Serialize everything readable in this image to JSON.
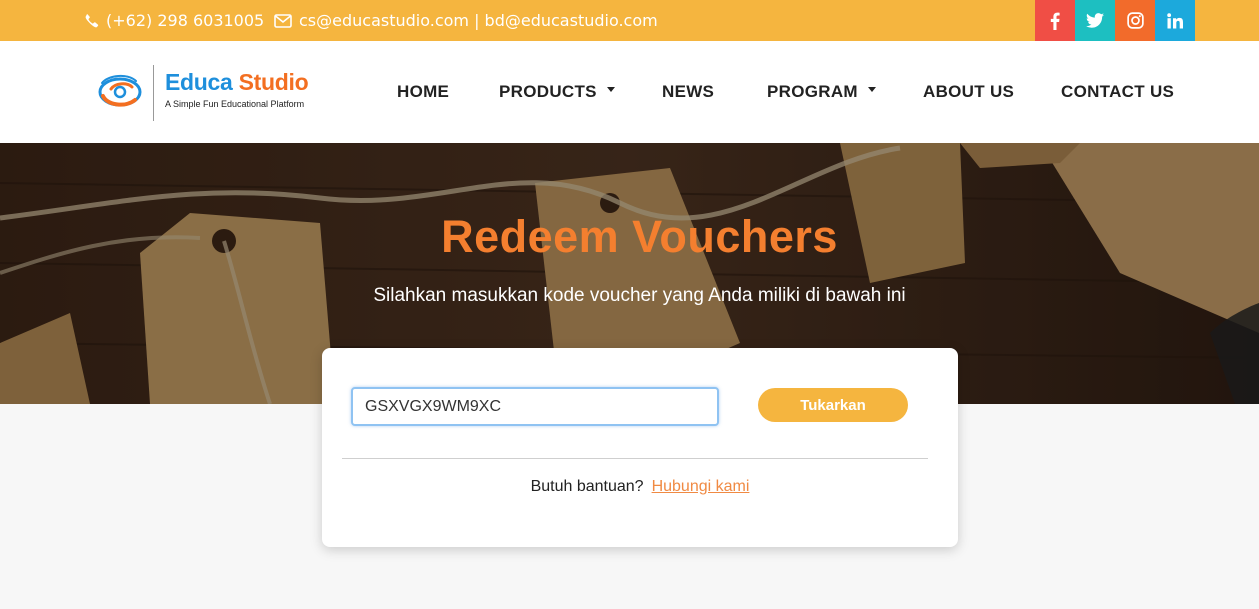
{
  "topbar": {
    "phone": "(+62) 298 6031005",
    "email": "cs@educastudio.com | bd@educastudio.com",
    "socials": [
      {
        "name": "facebook",
        "glyph": "f"
      },
      {
        "name": "twitter",
        "glyph": "twitter-bird"
      },
      {
        "name": "instagram",
        "glyph": "instagram"
      },
      {
        "name": "linkedin",
        "glyph": "in"
      }
    ],
    "color": "#f5b53f"
  },
  "header": {
    "logo_word1": "Educa",
    "logo_word2": "Studio",
    "tagline": "A Simple Fun Educational Platform",
    "nav": {
      "home": "HOME",
      "products": "PRODUCTS",
      "news": "NEWS",
      "program": "PROGRAM",
      "about": "ABOUT US",
      "contact": "CONTACT US"
    }
  },
  "hero": {
    "title": "Redeem Vouchers",
    "subtitle": "Silahkan masukkan kode voucher yang Anda miliki di bawah ini",
    "title_color": "#f47f2f"
  },
  "redeem": {
    "code_value": "GSXVGX9WM9XC",
    "button_label": "Tukarkan",
    "help_text": "Butuh bantuan?",
    "help_link": "Hubungi kami",
    "accent": "#f5b53f"
  }
}
